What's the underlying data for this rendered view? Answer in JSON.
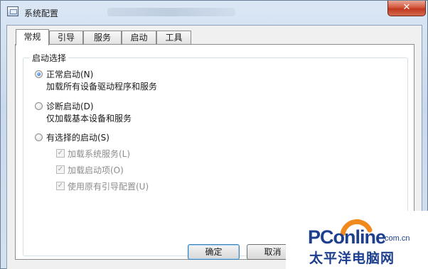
{
  "window": {
    "title": "系统配置",
    "close_glyph": "✕"
  },
  "tabs": [
    {
      "label": "常规",
      "active": true
    },
    {
      "label": "引导",
      "active": false
    },
    {
      "label": "服务",
      "active": false
    },
    {
      "label": "启动",
      "active": false
    },
    {
      "label": "工具",
      "active": false
    }
  ],
  "startup_group": {
    "caption": "启动选择",
    "normal": {
      "label": "正常启动(N)",
      "desc": "加载所有设备驱动程序和服务",
      "selected": true
    },
    "diagnostic": {
      "label": "诊断启动(D)",
      "desc": "仅加载基本设备和服务",
      "selected": false
    },
    "selective": {
      "label": "有选择的启动(S)",
      "selected": false,
      "options": [
        {
          "label": "加载系统服务(L)",
          "checked": true
        },
        {
          "label": "加载启动项(O)",
          "checked": true
        },
        {
          "label": "使用原有引导配置(U)",
          "checked": true
        }
      ]
    }
  },
  "buttons": {
    "ok": "确定",
    "cancel": "取消"
  },
  "watermark": {
    "brand": "PConline",
    "domain": ".com.cn",
    "cn": "太平洋电脑网"
  },
  "colors": {
    "accent": "#1f5fb8",
    "close_red": "#c0391f",
    "brand_blue": "#1d3f8e",
    "brand_orange": "#f08a1e"
  }
}
